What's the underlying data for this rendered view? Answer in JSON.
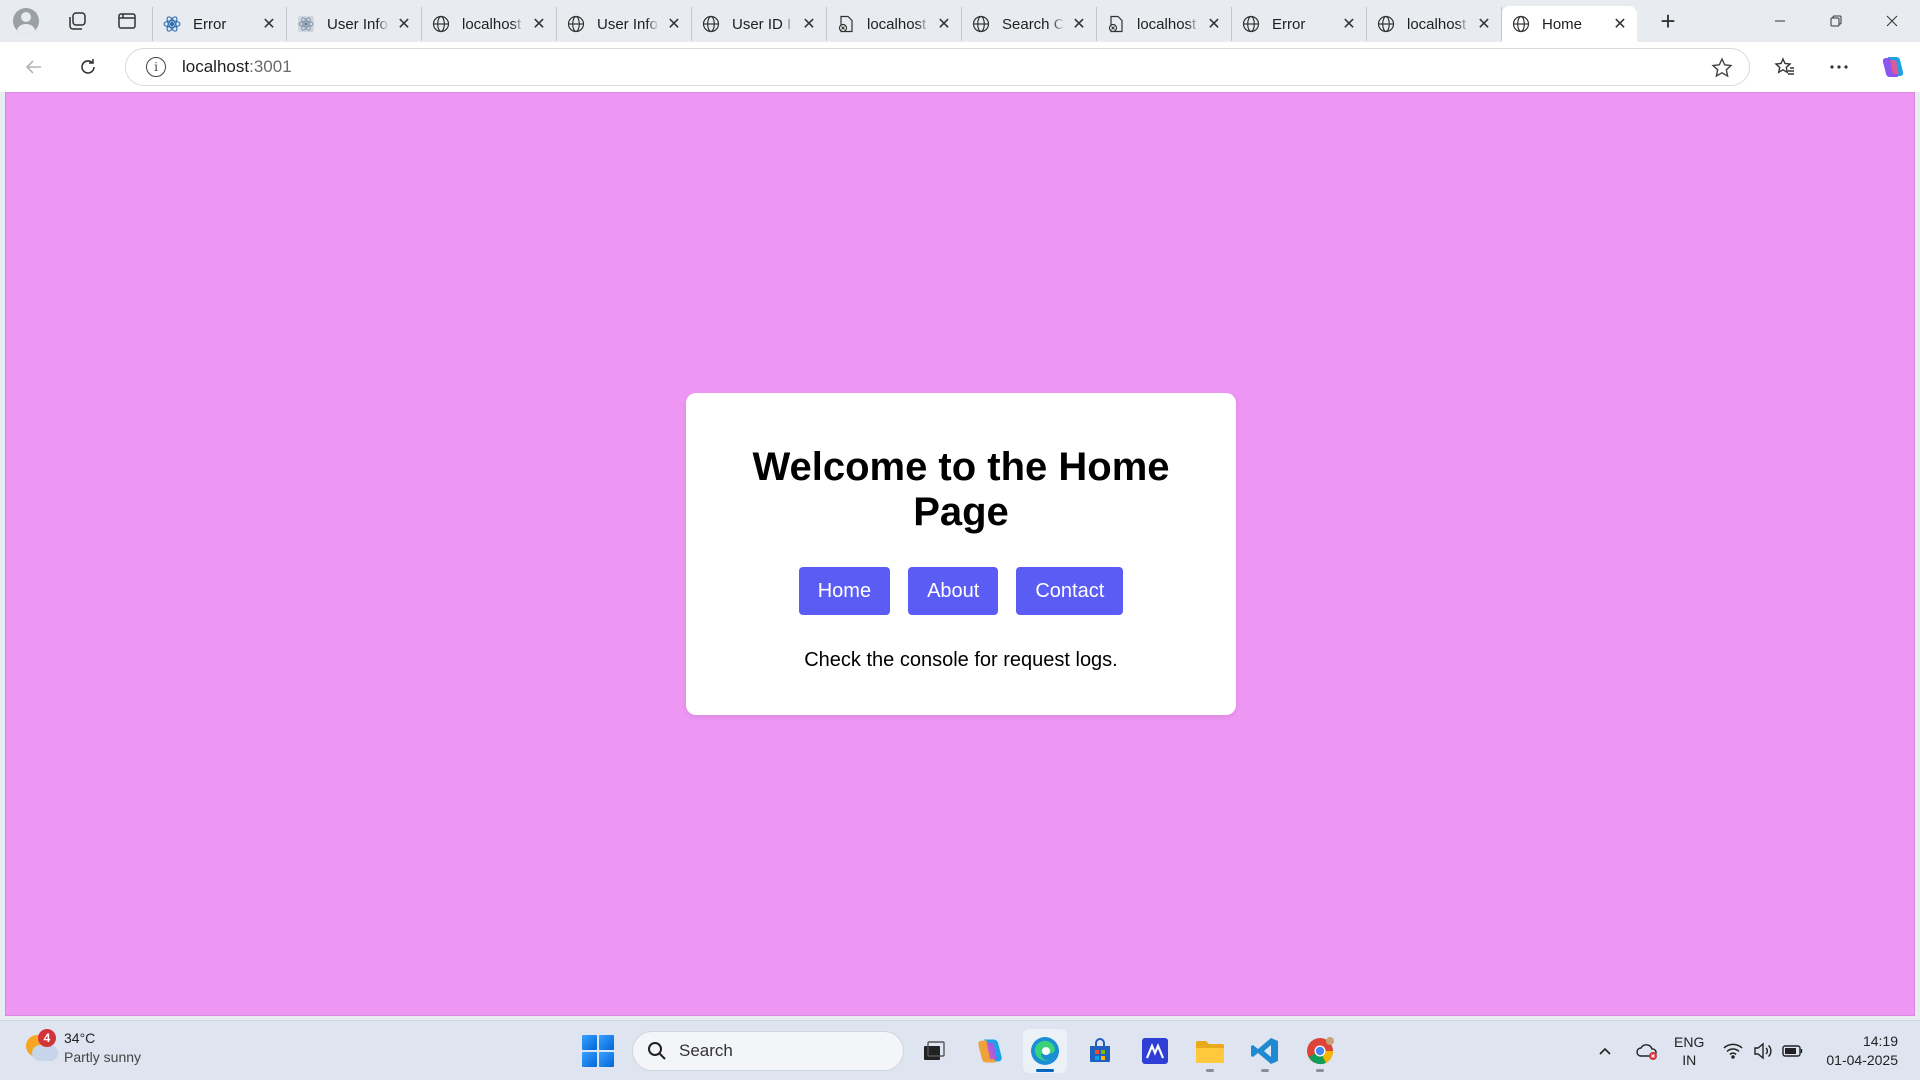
{
  "browser": {
    "tabs": [
      {
        "label": "Error",
        "icon": "react-icon"
      },
      {
        "label": "User Info",
        "icon": "react-icon"
      },
      {
        "label": "localhost",
        "icon": "globe-icon"
      },
      {
        "label": "User Info",
        "icon": "globe-icon"
      },
      {
        "label": "User ID I",
        "icon": "globe-icon"
      },
      {
        "label": "localhost",
        "icon": "error-page-icon"
      },
      {
        "label": "Search C",
        "icon": "globe-icon"
      },
      {
        "label": "localhost",
        "icon": "error-page-icon"
      },
      {
        "label": "Error",
        "icon": "globe-icon"
      },
      {
        "label": "localhost",
        "icon": "globe-icon"
      },
      {
        "label": "Home",
        "icon": "globe-icon",
        "active": true
      }
    ],
    "address": {
      "host": "localhost",
      "port": ":3001"
    }
  },
  "page": {
    "background": "#ee96f4",
    "heading": "Welcome to the Home Page",
    "buttons": {
      "home": "Home",
      "about": "About",
      "contact": "Contact"
    },
    "button_color": "#5b5cf4",
    "note": "Check the console for request logs."
  },
  "taskbar": {
    "weather": {
      "temp": "34°C",
      "condition": "Partly sunny",
      "badge": "4"
    },
    "search_placeholder": "Search",
    "language": {
      "lang": "ENG",
      "region": "IN"
    },
    "clock": {
      "time": "14:19",
      "date": "01-04-2025"
    }
  }
}
